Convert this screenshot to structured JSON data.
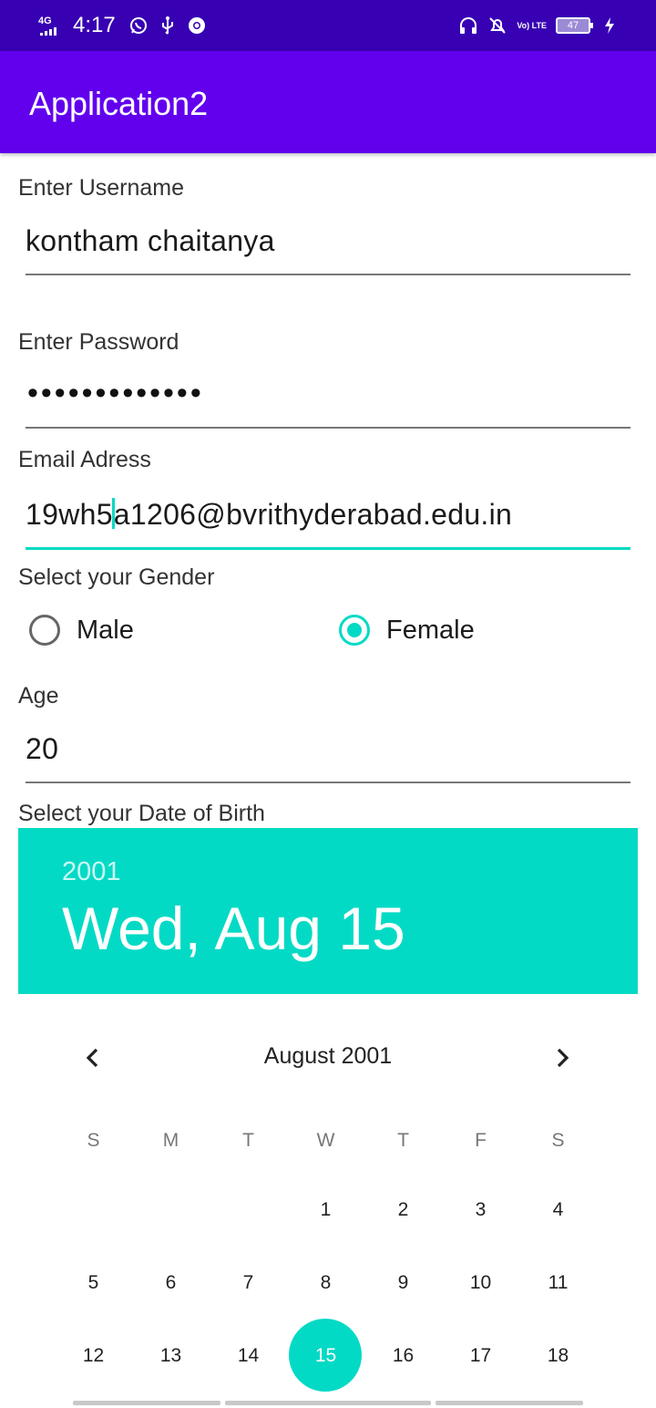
{
  "status_bar": {
    "network": "4G",
    "time": "4:17",
    "volte": "Vo) LTE",
    "battery": "47"
  },
  "app_bar": {
    "title": "Application2"
  },
  "form": {
    "username_label": "Enter Username",
    "username_value": "kontham chaitanya",
    "password_label": "Enter Password",
    "password_value": "•••••••••••••",
    "email_label": "Email Adress",
    "email_value_before_cursor": "19wh5",
    "email_value_after_cursor": "a1206@bvrithyderabad.edu.in",
    "gender_label": "Select your Gender",
    "gender_options": [
      "Male",
      "Female"
    ],
    "gender_selected": "Female",
    "age_label": "Age",
    "age_value": "20",
    "dob_label": "Select your Date of Birth"
  },
  "date_picker": {
    "header_year": "2001",
    "header_date": "Wed, Aug 15",
    "month_title": "August 2001",
    "weekdays": [
      "S",
      "M",
      "T",
      "W",
      "T",
      "F",
      "S"
    ],
    "weeks": [
      [
        "",
        "",
        "",
        "1",
        "2",
        "3",
        "4"
      ],
      [
        "5",
        "6",
        "7",
        "8",
        "9",
        "10",
        "11"
      ],
      [
        "12",
        "13",
        "14",
        "15",
        "16",
        "17",
        "18"
      ]
    ],
    "selected_day": "15",
    "accent_color": "#03DAC5"
  },
  "colors": {
    "status_bar": "#3700B3",
    "app_bar": "#6200EE",
    "accent": "#03DAC5"
  }
}
